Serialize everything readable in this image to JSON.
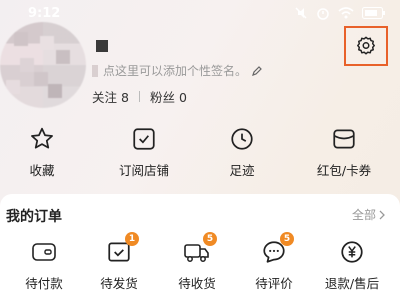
{
  "status": {
    "time": "9:12",
    "battery_label": ""
  },
  "profile": {
    "signature": "点这里可以添加个性签名。",
    "follow_label": "关注",
    "follow_count": "8",
    "fans_label": "粉丝",
    "fans_count": "0"
  },
  "quick_actions": [
    {
      "label": "收藏",
      "icon": "star-icon"
    },
    {
      "label": "订阅店铺",
      "icon": "store-check-icon"
    },
    {
      "label": "足迹",
      "icon": "clock-icon"
    },
    {
      "label": "红包/卡券",
      "icon": "coupon-icon"
    }
  ],
  "orders": {
    "title": "我的订单",
    "all_label": "全部",
    "items": [
      {
        "label": "待付款",
        "icon": "wallet-icon",
        "badge": ""
      },
      {
        "label": "待发货",
        "icon": "package-icon",
        "badge": "1"
      },
      {
        "label": "待收货",
        "icon": "truck-icon",
        "badge": "5"
      },
      {
        "label": "待评价",
        "icon": "comment-icon",
        "badge": "5"
      },
      {
        "label": "退款/售后",
        "icon": "refund-icon",
        "badge": ""
      }
    ]
  },
  "colors": {
    "highlight": "#e8612a",
    "badge": "#f08a24"
  }
}
